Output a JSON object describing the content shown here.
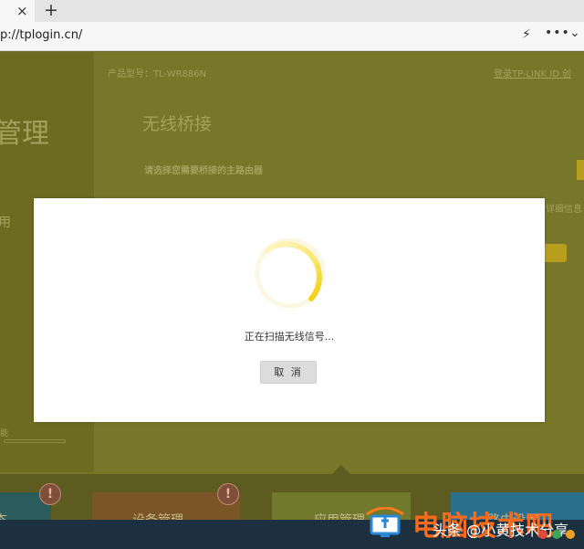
{
  "browser": {
    "tab_close": "×",
    "new_tab": "+",
    "url": "p://tplogin.cn/",
    "icons": [
      "close-icon",
      "plus-icon",
      "lightning-icon",
      "more-icon",
      "chevron-down-icon"
    ]
  },
  "router": {
    "side_title": "管理",
    "side_text": "用",
    "side_small": "能",
    "model": "产品型号：TL-WR886N",
    "login_link": "登录TP-LINK ID",
    "login_link2": "创",
    "main_title": "无线桥接",
    "instruction": "请选择您需要桥接的主路由器",
    "right_link": "详细信息",
    "cards": [
      {
        "label": "态"
      },
      {
        "label": "设备管理"
      },
      {
        "label": "应用管理"
      },
      {
        "label": "路由设置"
      }
    ],
    "alert_mark": "!"
  },
  "modal": {
    "message": "正在扫描无线信号...",
    "cancel_label": "取 消"
  },
  "watermark": {
    "brand": "电脑技术吧",
    "sub": "头条 @小黄技术分享"
  },
  "colors": {
    "overlay": "#787628",
    "spinner": "#f5d90a",
    "watermark_text": "#ff6a1a"
  }
}
